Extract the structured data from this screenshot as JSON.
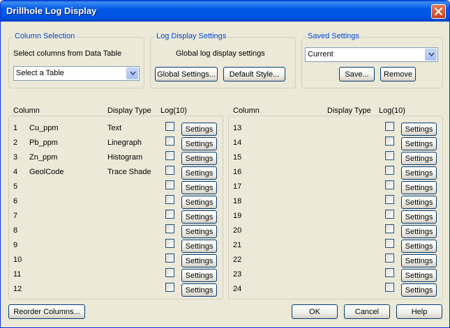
{
  "window": {
    "title": "Drillhole Log Display"
  },
  "column_selection": {
    "title": "Column Selection",
    "label": "Select columns from Data Table",
    "table_select_value": "Select a Table"
  },
  "log_display_settings": {
    "title": "Log Display Settings",
    "label": "Global log display settings",
    "global_button": "Global Settings...",
    "default_button": "Default Style..."
  },
  "saved_settings": {
    "title": "Saved Settings",
    "current_value": "Current",
    "save_button": "Save...",
    "remove_button": "Remove"
  },
  "left_table": {
    "headers": {
      "column": "Column",
      "display_type": "Display Type",
      "log": "Log(10)"
    },
    "rows": [
      {
        "num": "1",
        "name": "Cu_ppm",
        "type": "Text",
        "settings": "Settings"
      },
      {
        "num": "2",
        "name": "Pb_ppm",
        "type": "Linegraph",
        "settings": "Settings"
      },
      {
        "num": "3",
        "name": "Zn_ppm",
        "type": "Histogram",
        "settings": "Settings"
      },
      {
        "num": "4",
        "name": "GeolCode",
        "type": "Trace Shade",
        "settings": "Settings"
      },
      {
        "num": "5",
        "name": "",
        "type": "",
        "settings": "Settings"
      },
      {
        "num": "6",
        "name": "",
        "type": "",
        "settings": "Settings"
      },
      {
        "num": "7",
        "name": "",
        "type": "",
        "settings": "Settings"
      },
      {
        "num": "8",
        "name": "",
        "type": "",
        "settings": "Settings"
      },
      {
        "num": "9",
        "name": "",
        "type": "",
        "settings": "Settings"
      },
      {
        "num": "10",
        "name": "",
        "type": "",
        "settings": "Settings"
      },
      {
        "num": "11",
        "name": "",
        "type": "",
        "settings": "Settings"
      },
      {
        "num": "12",
        "name": "",
        "type": "",
        "settings": "Settings"
      }
    ]
  },
  "right_table": {
    "headers": {
      "column": "Column",
      "display_type": "Display Type",
      "log": "Log(10)"
    },
    "rows": [
      {
        "num": "13",
        "name": "",
        "type": "",
        "settings": "Settings"
      },
      {
        "num": "14",
        "name": "",
        "type": "",
        "settings": "Settings"
      },
      {
        "num": "15",
        "name": "",
        "type": "",
        "settings": "Settings"
      },
      {
        "num": "16",
        "name": "",
        "type": "",
        "settings": "Settings"
      },
      {
        "num": "17",
        "name": "",
        "type": "",
        "settings": "Settings"
      },
      {
        "num": "18",
        "name": "",
        "type": "",
        "settings": "Settings"
      },
      {
        "num": "19",
        "name": "",
        "type": "",
        "settings": "Settings"
      },
      {
        "num": "20",
        "name": "",
        "type": "",
        "settings": "Settings"
      },
      {
        "num": "21",
        "name": "",
        "type": "",
        "settings": "Settings"
      },
      {
        "num": "22",
        "name": "",
        "type": "",
        "settings": "Settings"
      },
      {
        "num": "23",
        "name": "",
        "type": "",
        "settings": "Settings"
      },
      {
        "num": "24",
        "name": "",
        "type": "",
        "settings": "Settings"
      }
    ]
  },
  "footer": {
    "reorder_button": "Reorder Columns...",
    "ok_button": "OK",
    "cancel_button": "Cancel",
    "help_button": "Help"
  },
  "colors": {
    "titlebar": "#0054e3",
    "dialog_bg": "#ece9d8",
    "group_title": "#0046d5",
    "close_button": "#c4401c"
  },
  "icons": {
    "close": "close-icon",
    "dropdown": "chevron-down-icon"
  }
}
